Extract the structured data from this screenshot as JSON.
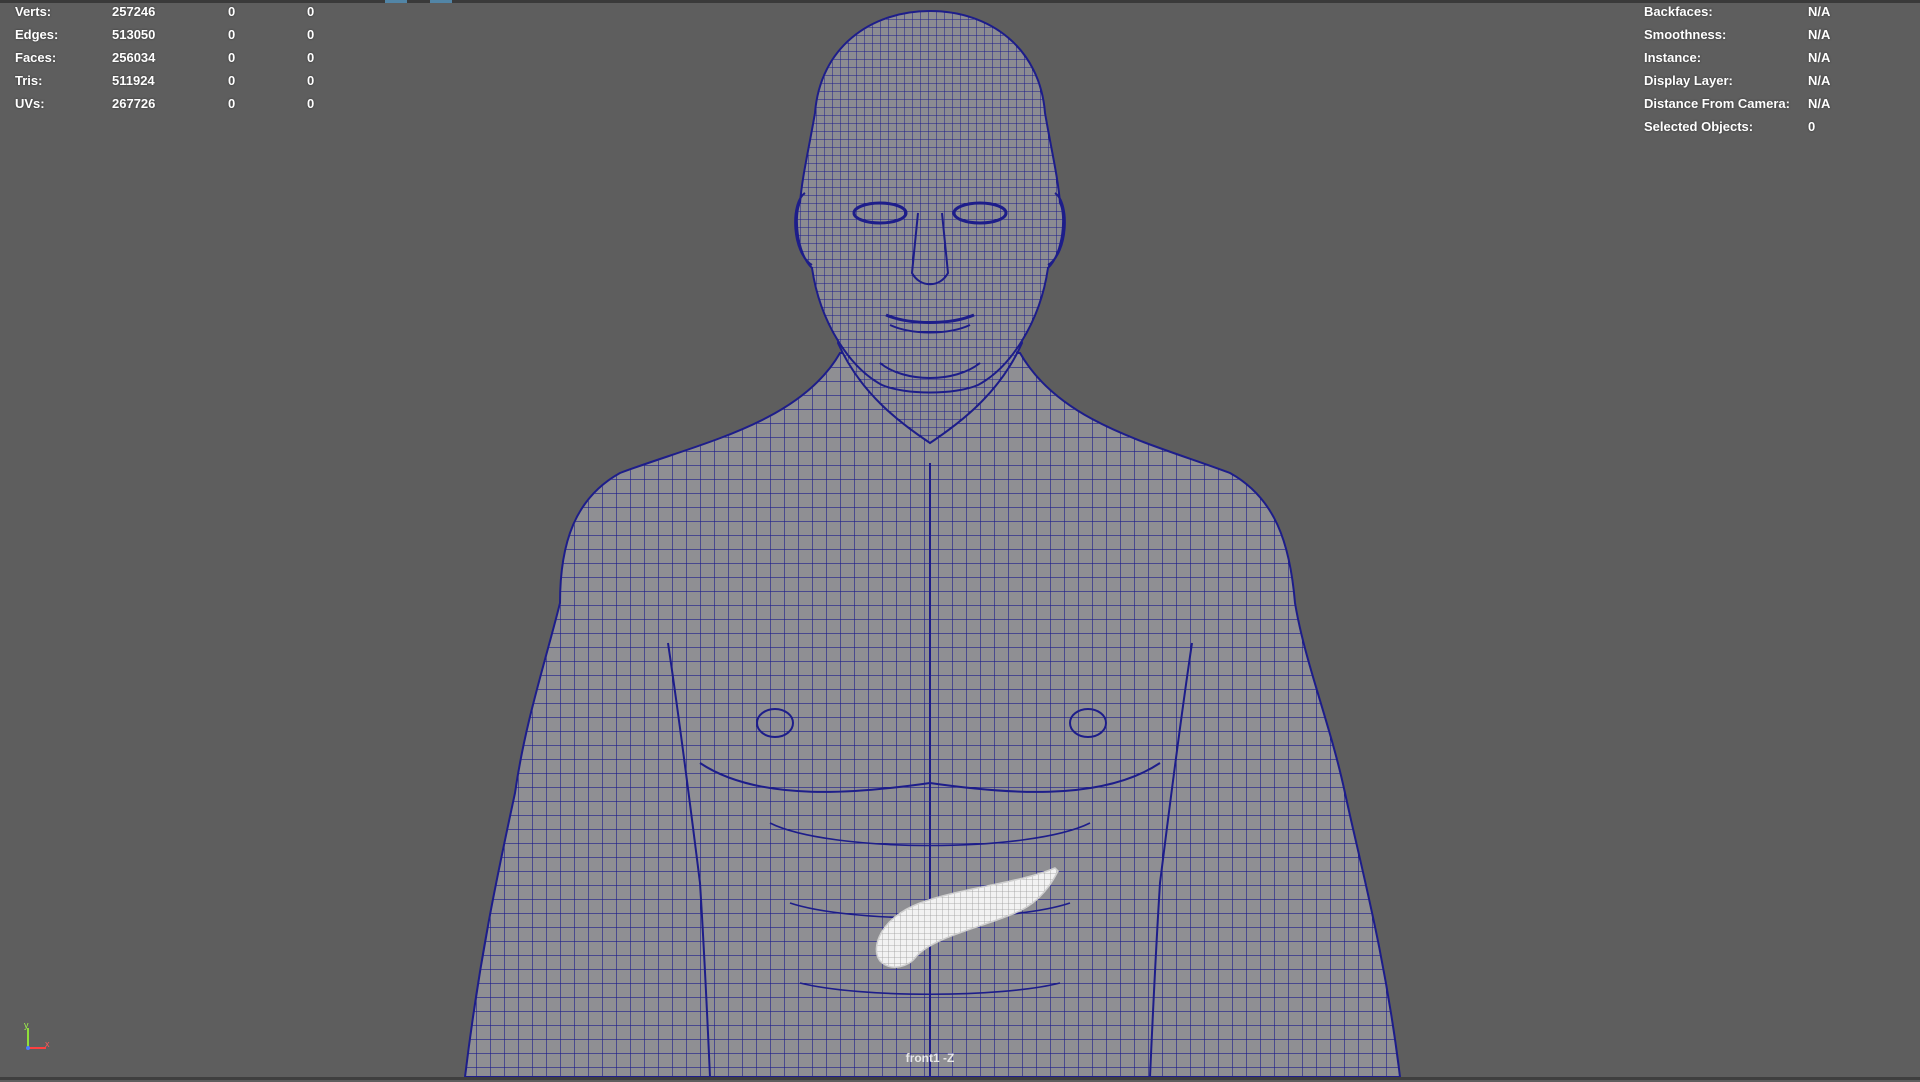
{
  "stats": {
    "rows": [
      {
        "label": "Verts:",
        "v1": "257246",
        "v2": "0",
        "v3": "0"
      },
      {
        "label": "Edges:",
        "v1": "513050",
        "v2": "0",
        "v3": "0"
      },
      {
        "label": "Faces:",
        "v1": "256034",
        "v2": "0",
        "v3": "0"
      },
      {
        "label": "Tris:",
        "v1": "511924",
        "v2": "0",
        "v3": "0"
      },
      {
        "label": "UVs:",
        "v1": "267726",
        "v2": "0",
        "v3": "0"
      }
    ]
  },
  "object_info": {
    "rows": [
      {
        "label": "Backfaces:",
        "value": "N/A"
      },
      {
        "label": "Smoothness:",
        "value": "N/A"
      },
      {
        "label": "Instance:",
        "value": "N/A"
      },
      {
        "label": "Display Layer:",
        "value": "N/A"
      },
      {
        "label": "Distance From Camera:",
        "value": "N/A"
      },
      {
        "label": "Selected Objects:",
        "value": "0"
      }
    ]
  },
  "viewport": {
    "camera_label": "front1 -Z",
    "axis": {
      "y": "y",
      "x": "x"
    },
    "colors": {
      "background": "#5e5e5e",
      "mesh_fill": "#8f8f93",
      "wireframe": "#1d1d8a",
      "selected_object": "#f2f2f2"
    }
  },
  "icons": [
    "axis-gizmo-icon"
  ]
}
